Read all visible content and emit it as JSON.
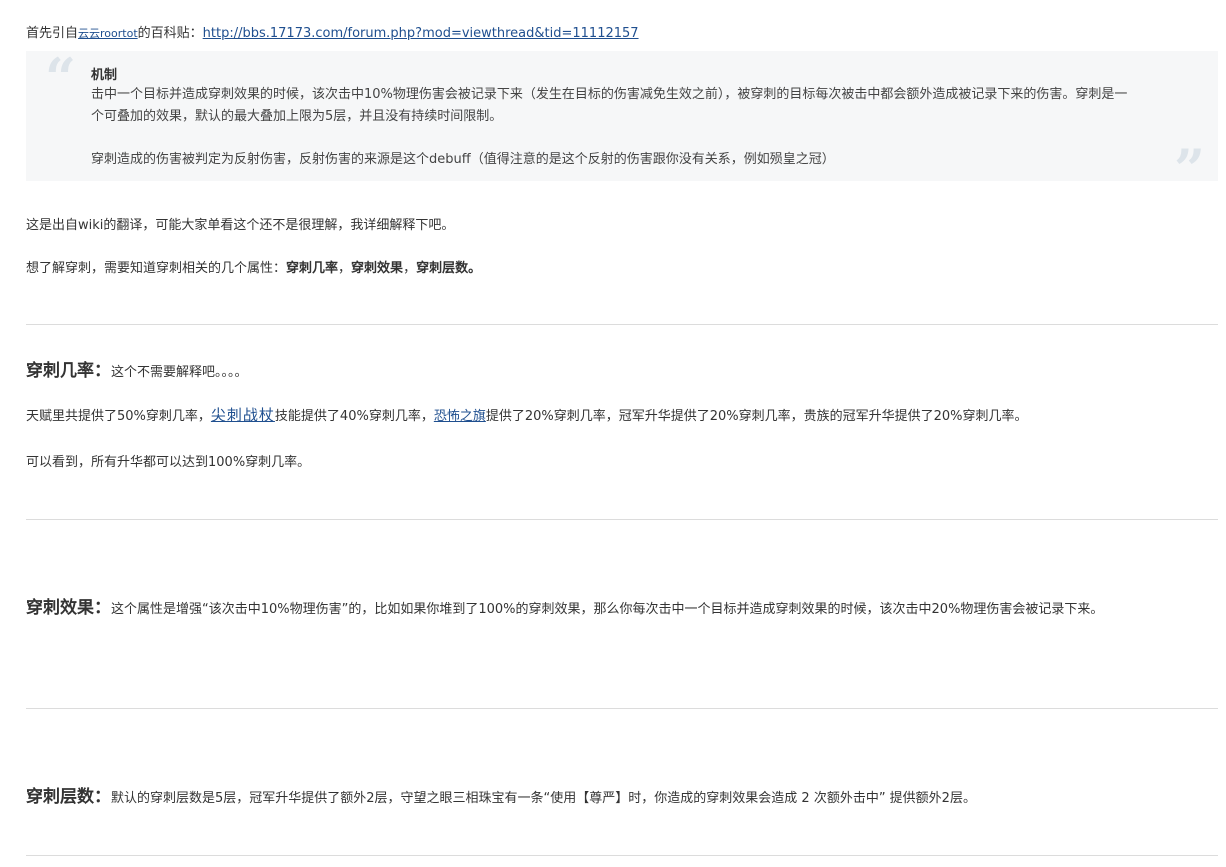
{
  "intro": {
    "prefix": "首先引自",
    "author_link": "云云roortot",
    "middle": "的百科贴：",
    "url": "http://bbs.17173.com/forum.php?mod=viewthread&tid=11112157"
  },
  "quote": {
    "title": "机制",
    "p1": "击中一个目标并造成穿刺效果的时候，该次击中10%物理伤害会被记录下来（发生在目标的伤害减免生效之前），被穿刺的目标每次被击中都会额外造成被记录下来的伤害。穿刺是一个可叠加的效果，默认的最大叠加上限为5层，并且没有持续时间限制。",
    "p2": "穿刺造成的伤害被判定为反射伤害，反射伤害的来源是这个debuff（值得注意的是这个反射的伤害跟你没有关系，例如殒皇之冠）"
  },
  "para1": "这是出自wiki的翻译，可能大家单看这个还不是很理解，我详细解释下吧。",
  "para2": {
    "text": "想了解穿刺，需要知道穿刺相关的几个属性：",
    "b1": "穿刺几率",
    "sep1": "，",
    "b2": "穿刺效果",
    "sep2": "，",
    "b3": "穿刺层数。"
  },
  "section1": {
    "heading": "穿刺几率：",
    "desc": "这个不需要解释吧。。。。",
    "line1_a": "天赋里共提供了50%穿刺几率，",
    "line1_link1": "尖刺战杖",
    "line1_b": "技能提供了40%穿刺几率，",
    "line1_link2": "恐怖之旗",
    "line1_c": "提供了20%穿刺几率，冠军升华提供了20%穿刺几率，贵族的冠军升华提供了20%穿刺几率。",
    "line2": "可以看到，所有升华都可以达到100%穿刺几率。"
  },
  "section2": {
    "heading": "穿刺效果：",
    "desc": "这个属性是增强“该次击中10%物理伤害”的，比如如果你堆到了100%的穿刺效果，那么你每次击中一个目标并造成穿刺效果的时候，该次击中20%物理伤害会被记录下来。"
  },
  "section3": {
    "heading": "穿刺层数：",
    "desc": "默认的穿刺层数是5层，冠军升华提供了额外2层，守望之眼三相珠宝有一条“使用【尊严】时，你造成的穿刺效果会造成 2 次额外击中” 提供额外2层。"
  }
}
